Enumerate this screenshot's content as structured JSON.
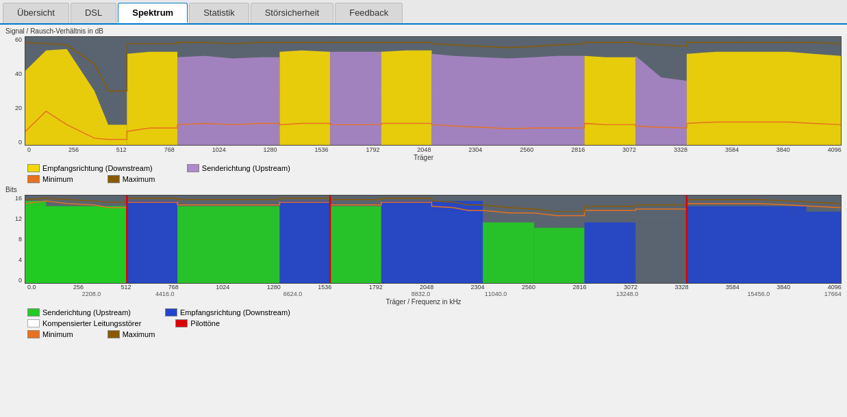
{
  "tabs": [
    {
      "label": "Übersicht",
      "active": false
    },
    {
      "label": "DSL",
      "active": false
    },
    {
      "label": "Spektrum",
      "active": true
    },
    {
      "label": "Statistik",
      "active": false
    },
    {
      "label": "Störsicherheit",
      "active": false
    },
    {
      "label": "Feedback",
      "active": false
    }
  ],
  "snr_chart": {
    "ylabel": "Signal / Rausch-Verhältnis in dB",
    "xlabel": "Träger",
    "yticks": [
      "60",
      "40",
      "20",
      "0"
    ],
    "xticks": [
      "0",
      "256",
      "512",
      "768",
      "1024",
      "1280",
      "1536",
      "1792",
      "2048",
      "2304",
      "2560",
      "2816",
      "3072",
      "3328",
      "3584",
      "3840",
      "4096"
    ],
    "legend": [
      {
        "color": "#f5d800",
        "label": "Empfangsrichtung (Downstream)"
      },
      {
        "color": "#b088cc",
        "label": "Senderichtung (Upstream)"
      },
      {
        "color": "#e87020",
        "label": "Minimum"
      },
      {
        "color": "#8b5a00",
        "label": "Maximum"
      }
    ]
  },
  "bits_chart": {
    "ylabel": "Bits",
    "xlabel": "Träger / Frequenz in kHz",
    "yticks": [
      "16",
      "12",
      "8",
      "4",
      "0"
    ],
    "xticks_top": [
      "0.0",
      "256",
      "512",
      "768",
      "1024",
      "1280",
      "1536",
      "1792",
      "2048",
      "2304",
      "2560",
      "2816",
      "3072",
      "3328",
      "3584",
      "3840",
      "4096"
    ],
    "xticks_bottom": [
      "",
      "2208.0",
      "4416.0",
      "",
      "6624.0",
      "",
      "8832.0",
      "11040.0",
      "",
      "13248.0",
      "",
      "15456.0",
      "17664"
    ],
    "legend": [
      {
        "color": "#22cc22",
        "label": "Senderichtung (Upstream)"
      },
      {
        "color": "#2244cc",
        "label": "Empfangsrichtung (Downstream)"
      },
      {
        "color": "#ffffff",
        "label": "Kompensierter Leitungsstörer",
        "outline": true
      },
      {
        "color": "#dd0000",
        "label": "Pilottöne"
      },
      {
        "color": "#e87020",
        "label": "Minimum"
      },
      {
        "color": "#8b5a00",
        "label": "Maximum"
      }
    ]
  }
}
